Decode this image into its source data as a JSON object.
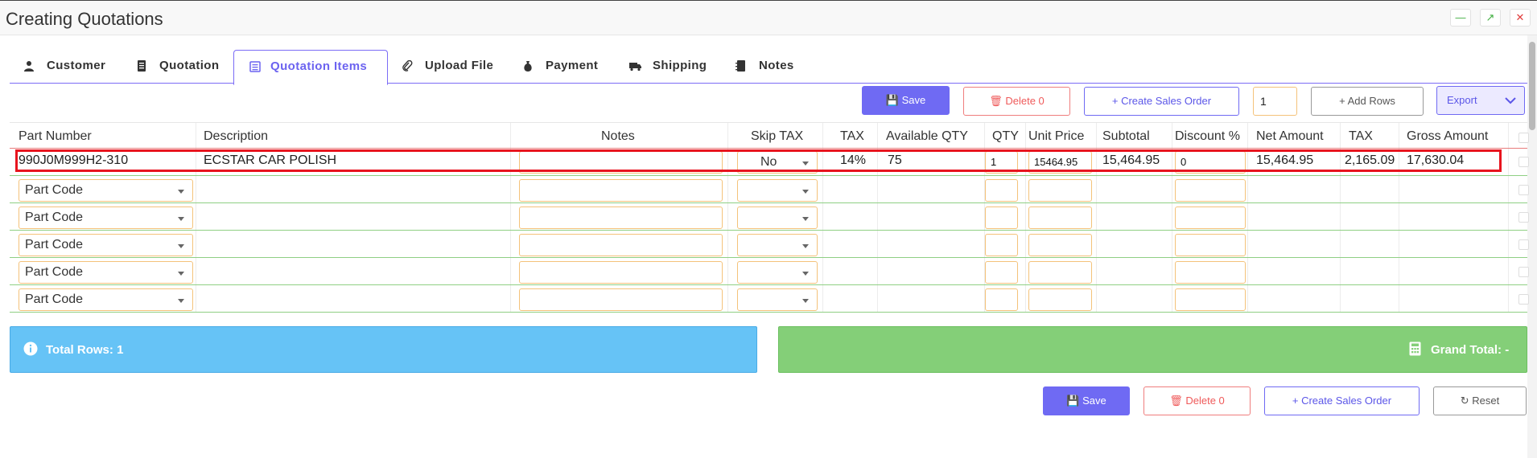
{
  "window": {
    "title": "Creating Quotations",
    "controls": [
      "minimize",
      "maximize",
      "close"
    ]
  },
  "tabs": [
    {
      "label": "Customer",
      "icon": "user-icon"
    },
    {
      "label": "Quotation",
      "icon": "document-icon"
    },
    {
      "label": "Quotation Items",
      "icon": "list-icon",
      "active": true
    },
    {
      "label": "Upload File",
      "icon": "paperclip-icon"
    },
    {
      "label": "Payment",
      "icon": "money-bag-icon"
    },
    {
      "label": "Shipping",
      "icon": "truck-icon"
    },
    {
      "label": "Notes",
      "icon": "notebook-icon"
    }
  ],
  "toolbar": {
    "save_label": "Save",
    "delete_label": "Delete",
    "delete_count": "0",
    "create_sales_order_label": "+ Create Sales Order",
    "rows_count": "1",
    "add_rows_label": "+ Add Rows",
    "export_label": "Export"
  },
  "table": {
    "headers": [
      "Part Number",
      "Description",
      "Notes",
      "Skip TAX",
      "TAX",
      "Available QTY",
      "QTY",
      "Unit Price",
      "Subtotal",
      "Discount %",
      "Net Amount",
      "TAX",
      "Gross Amount"
    ],
    "item": {
      "part_number": "990J0M999H2-310",
      "description": "ECSTAR CAR POLISH",
      "notes": "",
      "skip_tax": "No",
      "tax_rate": "14%",
      "available_qty": "75",
      "qty": "1",
      "unit_price": "15464.95",
      "subtotal": "15,464.95",
      "discount": "0",
      "net_amount": "15,464.95",
      "tax_amount": "2,165.09",
      "gross_amount": "17,630.04"
    },
    "empty_row_placeholder": "Part Code",
    "empty_rows": 5
  },
  "summary": {
    "total_rows_label": "Total Rows:",
    "total_rows_value": "1",
    "grand_total_label": "Grand Total: -"
  },
  "footer": {
    "save_label": "Save",
    "delete_label": "Delete",
    "delete_count": "0",
    "create_sales_order_label": "+ Create Sales Order",
    "reset_label": "Reset"
  },
  "colors": {
    "accent": "#6f6af3",
    "danger": "#ef5a5a",
    "info": "#66c3f6",
    "success": "#84cf78",
    "input_border": "#f4c27a",
    "highlight": "#e8141e"
  }
}
